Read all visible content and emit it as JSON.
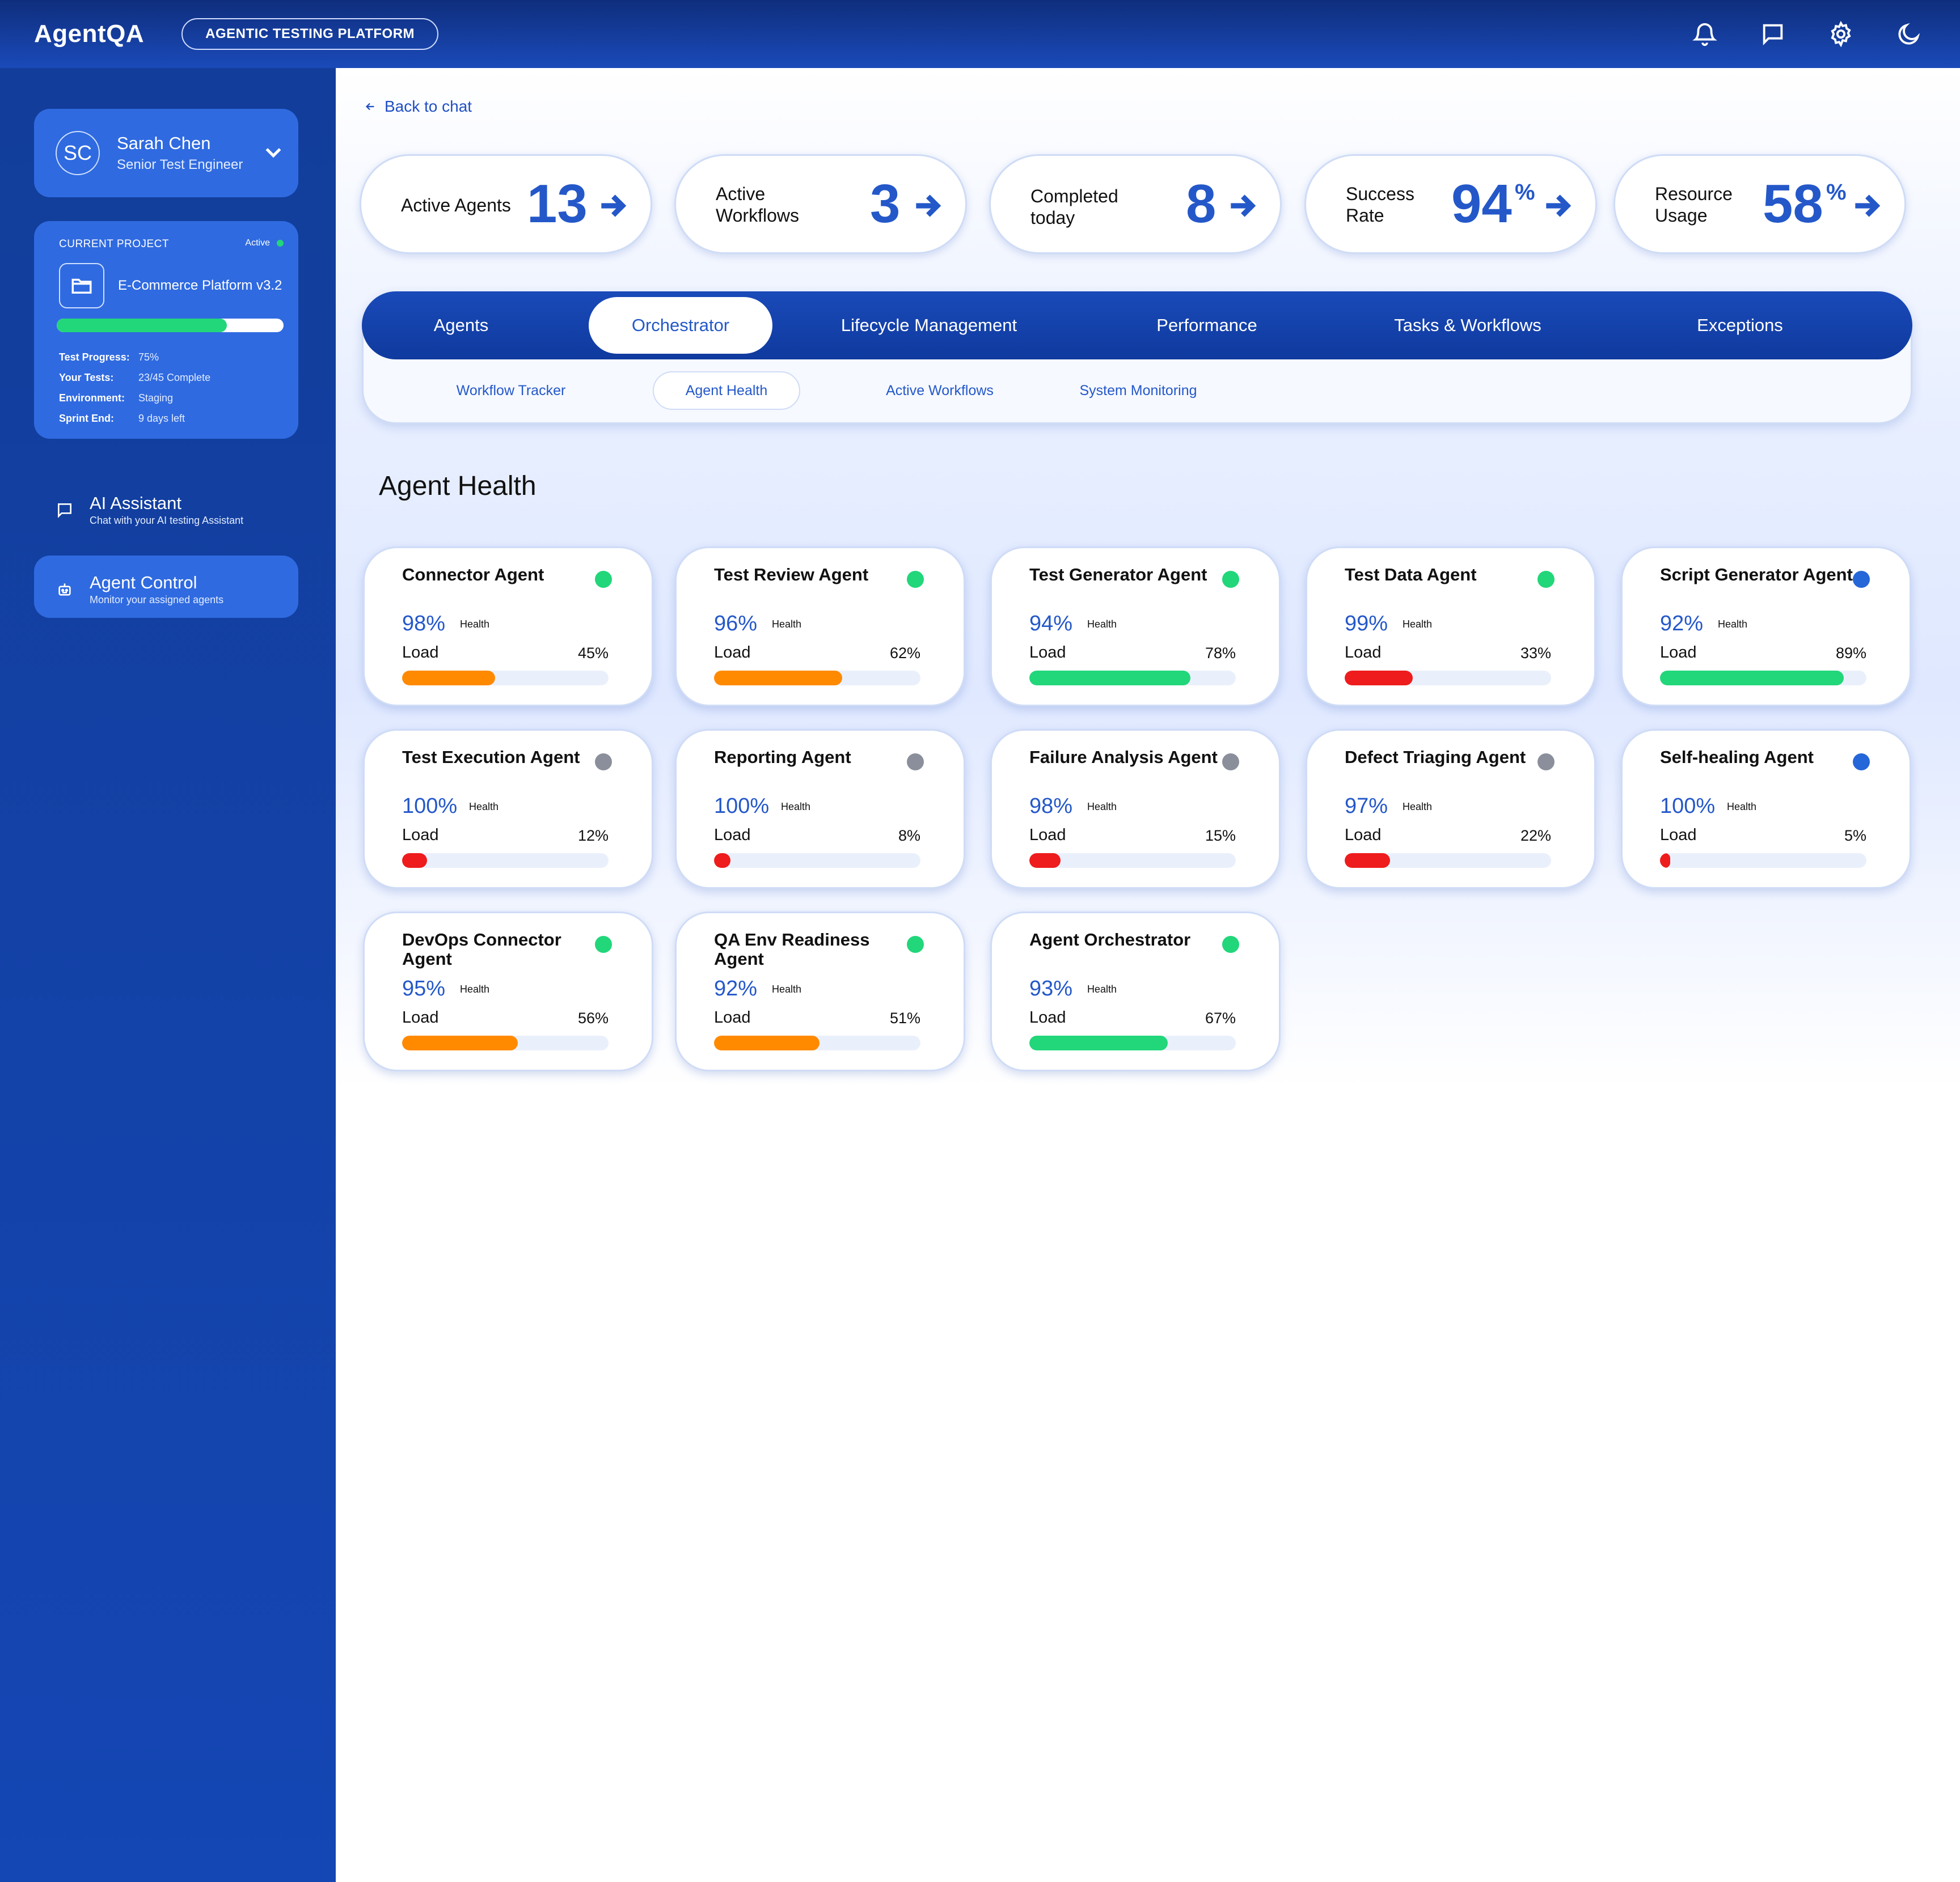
{
  "app": {
    "brand": "AgentQA",
    "platform_badge": "AGENTIC TESTING PLATFORM"
  },
  "header_icons": [
    "bell-icon",
    "chat-icon",
    "gear-icon",
    "moon-icon"
  ],
  "user": {
    "initials": "SC",
    "name": "Sarah Chen",
    "role": "Senior Test Engineer"
  },
  "project": {
    "heading": "CURRENT PROJECT",
    "status": "Active",
    "name": "E-Commerce Platform v3.2",
    "progress": 0.75,
    "rows": [
      {
        "label": "Test Progress:",
        "value": "75%"
      },
      {
        "label": "Your Tests:",
        "value": "23/45 Complete"
      },
      {
        "label": "Environment:",
        "value": "Staging"
      },
      {
        "label": "Sprint End:",
        "value": "9 days left"
      }
    ]
  },
  "nav": {
    "ai_assistant": {
      "title": "AI Assistant",
      "subtitle": "Chat with your AI testing Assistant"
    },
    "agent_control": {
      "title": "Agent Control",
      "subtitle": "Monitor your assigned agents"
    }
  },
  "back_link": "Back to chat",
  "stats": [
    {
      "label": "Active Agents",
      "value": "13",
      "suffix": ""
    },
    {
      "label": "Active Workflows",
      "value": "3",
      "suffix": ""
    },
    {
      "label": "Completed today",
      "value": "8",
      "suffix": ""
    },
    {
      "label": "Success Rate",
      "value": "94",
      "suffix": "%"
    },
    {
      "label": "Resource Usage",
      "value": "58",
      "suffix": "%"
    }
  ],
  "tabs": [
    "Agents",
    "Orchestrator",
    "Lifecycle Management",
    "Performance",
    "Tasks & Workflows",
    "Exceptions"
  ],
  "active_tab": "Orchestrator",
  "subtabs": [
    "Workflow Tracker",
    "Agent Health",
    "Active Workflows",
    "System Monitoring"
  ],
  "active_subtab": "Agent Health",
  "section_title": "Agent Health",
  "health_label": "Health",
  "load_label": "Load",
  "colors": {
    "green": "#22d67a",
    "gray": "#8a8f9b",
    "blue": "#2566d8",
    "orange": "#ff8a00",
    "red": "#ee1c1c",
    "accent": "#2458c9"
  },
  "agents": [
    {
      "name": "Connector Agent",
      "status": "green",
      "health": "98%",
      "load": "45%",
      "bar": "orange"
    },
    {
      "name": "Test Review Agent",
      "status": "green",
      "health": "96%",
      "load": "62%",
      "bar": "orange"
    },
    {
      "name": "Test Generator Agent",
      "status": "green",
      "health": "94%",
      "load": "78%",
      "bar": "green"
    },
    {
      "name": "Test Data Agent",
      "status": "green",
      "health": "99%",
      "load": "33%",
      "bar": "red"
    },
    {
      "name": "Script Generator Agent",
      "status": "blue",
      "health": "92%",
      "load": "89%",
      "bar": "green"
    },
    {
      "name": "Test Execution Agent",
      "status": "gray",
      "health": "100%",
      "load": "12%",
      "bar": "red"
    },
    {
      "name": "Reporting Agent",
      "status": "gray",
      "health": "100%",
      "load": "8%",
      "bar": "red"
    },
    {
      "name": "Failure Analysis Agent",
      "status": "gray",
      "health": "98%",
      "load": "15%",
      "bar": "red"
    },
    {
      "name": "Defect Triaging Agent",
      "status": "gray",
      "health": "97%",
      "load": "22%",
      "bar": "red"
    },
    {
      "name": "Self-healing Agent",
      "status": "blue",
      "health": "100%",
      "load": "5%",
      "bar": "red"
    },
    {
      "name": "DevOps Connector Agent",
      "status": "green",
      "health": "95%",
      "load": "56%",
      "bar": "orange"
    },
    {
      "name": "QA Env Readiness Agent",
      "status": "green",
      "health": "92%",
      "load": "51%",
      "bar": "orange"
    },
    {
      "name": "Agent Orchestrator",
      "status": "green",
      "health": "93%",
      "load": "67%",
      "bar": "green"
    }
  ]
}
